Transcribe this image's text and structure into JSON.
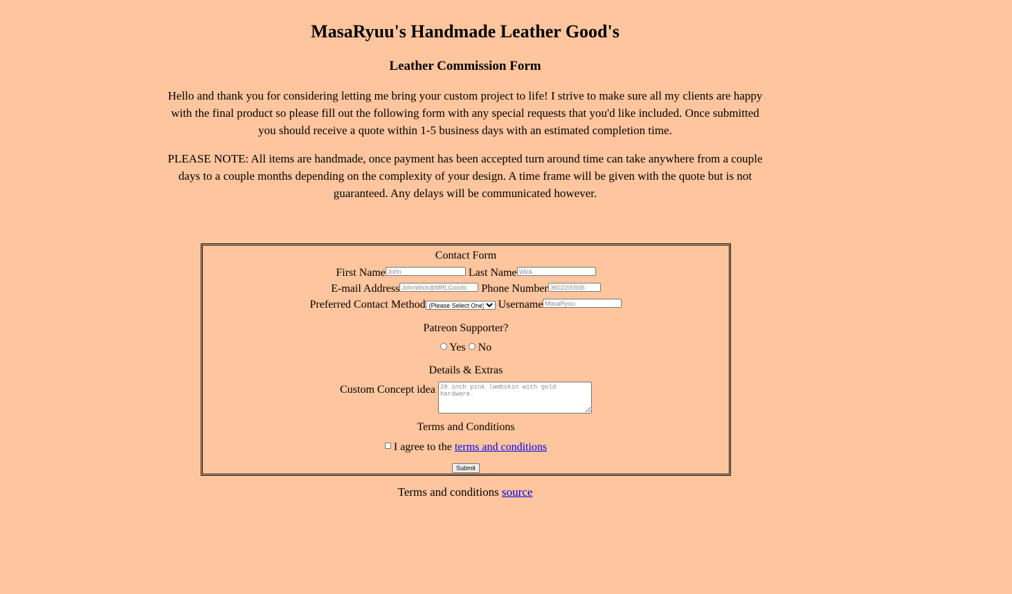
{
  "header": {
    "title": "MasaRyuu's Handmade Leather Good's",
    "subtitle": "Leather Commission Form",
    "intro": "Hello and thank you for considering letting me bring your custom project to life! I strive to make sure all my clients are happy with the final product so please fill out the following form with any special requests that you'd like included. Once submitted you should receive a quote within 1-5 business days with an estimated completion time.",
    "note": "PLEASE NOTE: All items are handmade, once payment has been accepted turn around time can take anywhere from a couple days to a couple months depending on the complexity of your design. A time frame will be given with the quote but is not guaranteed. Any delays will be communicated however."
  },
  "form": {
    "legend": "Contact Form",
    "first_name": {
      "label": "First Name",
      "placeholder": "John",
      "value": ""
    },
    "last_name": {
      "label": "Last Name",
      "placeholder": "Wick",
      "value": ""
    },
    "email": {
      "label": "E-mail Address",
      "placeholder": "JohnWick@MRLGoods",
      "value": ""
    },
    "phone": {
      "label": "Phone Number",
      "placeholder": "3602200936",
      "value": ""
    },
    "contact_method": {
      "label": "Preferred Contact Method",
      "selected": "(Please Select One)"
    },
    "username": {
      "label": "Username",
      "placeholder": "MasaRyuu",
      "value": ""
    },
    "patreon": {
      "heading": "Patreon Supporter?",
      "options": [
        "Yes",
        "No"
      ]
    },
    "details": {
      "heading": "Details & Extras",
      "concept_label": "Custom Concept idea",
      "concept_placeholder": "20 inch pink lambskin with gold hardware."
    },
    "terms": {
      "heading": "Terms and Conditions",
      "agree_text": "I agree to the",
      "link_text": "terms and conditions"
    },
    "submit_label": "Submit"
  },
  "footer": {
    "text": "Terms and conditions",
    "link_text": "source"
  },
  "colors": {
    "background": "#ffc59e",
    "link": "#0000ee"
  }
}
